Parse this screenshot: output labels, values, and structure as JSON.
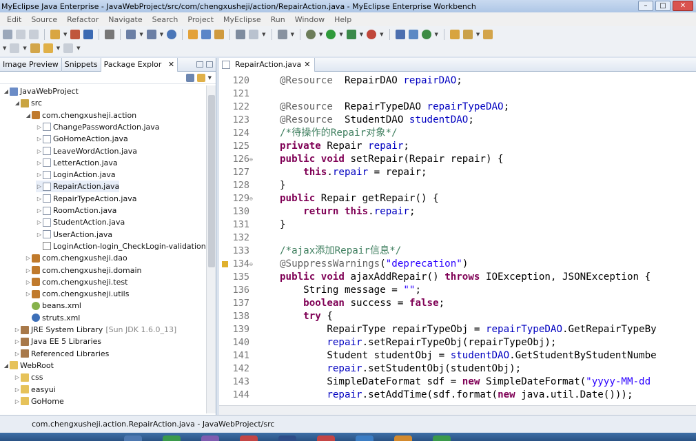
{
  "window": {
    "title": "MyEclipse Java Enterprise - JavaWebProject/src/com/chengxusheji/action/RepairAction.java - MyEclipse Enterprise Workbench"
  },
  "menu": [
    "Edit",
    "Source",
    "Refactor",
    "Navigate",
    "Search",
    "Project",
    "MyEclipse",
    "Run",
    "Window",
    "Help"
  ],
  "left_panel": {
    "tabs": [
      "Image Preview",
      "Snippets",
      "Package Explor"
    ],
    "tree": [
      {
        "label": "JavaWebProject",
        "icon": "project-icon"
      },
      {
        "label": "src",
        "icon": "source-folder-icon"
      },
      {
        "label": "com.chengxusheji.action",
        "icon": "package-icon"
      },
      {
        "label": "ChangePasswordAction.java",
        "icon": "java-file-icon"
      },
      {
        "label": "GoHomeAction.java",
        "icon": "java-file-icon"
      },
      {
        "label": "LeaveWordAction.java",
        "icon": "java-file-icon"
      },
      {
        "label": "LetterAction.java",
        "icon": "java-file-icon"
      },
      {
        "label": "LoginAction.java",
        "icon": "java-file-icon"
      },
      {
        "label": "RepairAction.java",
        "icon": "java-file-icon"
      },
      {
        "label": "RepairTypeAction.java",
        "icon": "java-file-icon"
      },
      {
        "label": "RoomAction.java",
        "icon": "java-file-icon"
      },
      {
        "label": "StudentAction.java",
        "icon": "java-file-icon"
      },
      {
        "label": "UserAction.java",
        "icon": "java-file-icon"
      },
      {
        "label": "LoginAction-login_CheckLogin-validation.xml",
        "icon": "xml-file-icon"
      },
      {
        "label": "com.chengxusheji.dao",
        "icon": "package-icon"
      },
      {
        "label": "com.chengxusheji.domain",
        "icon": "package-icon"
      },
      {
        "label": "com.chengxusheji.test",
        "icon": "package-icon"
      },
      {
        "label": "com.chengxusheji.utils",
        "icon": "package-icon"
      },
      {
        "label": "beans.xml",
        "icon": "beans-xml-icon"
      },
      {
        "label": "struts.xml",
        "icon": "struts-xml-icon"
      },
      {
        "label": "JRE System Library",
        "suffix": "[Sun JDK 1.6.0_13]",
        "icon": "library-icon"
      },
      {
        "label": "Java EE 5 Libraries",
        "icon": "library-icon"
      },
      {
        "label": "Referenced Libraries",
        "icon": "library-icon"
      },
      {
        "label": "WebRoot",
        "icon": "folder-icon"
      },
      {
        "label": "css",
        "icon": "folder-icon"
      },
      {
        "label": "easyui",
        "icon": "folder-icon"
      },
      {
        "label": "GoHome",
        "icon": "folder-icon"
      }
    ]
  },
  "editor": {
    "tab_label": "RepairAction.java",
    "lines": [
      {
        "n": "120",
        "tokens": [
          [
            "ann",
            "@Resource"
          ],
          [
            "",
            "  RepairDAO "
          ],
          [
            "fld",
            "repairDAO"
          ],
          [
            "",
            ";"
          ]
        ]
      },
      {
        "n": "121",
        "tokens": []
      },
      {
        "n": "122",
        "tokens": [
          [
            "ann",
            "@Resource"
          ],
          [
            "",
            "  RepairTypeDAO "
          ],
          [
            "fld",
            "repairTypeDAO"
          ],
          [
            "",
            ";"
          ]
        ]
      },
      {
        "n": "123",
        "tokens": [
          [
            "ann",
            "@Resource"
          ],
          [
            "",
            "  StudentDAO "
          ],
          [
            "fld",
            "studentDAO"
          ],
          [
            "",
            ";"
          ]
        ]
      },
      {
        "n": "124",
        "tokens": [
          [
            "cmt",
            "/*待操作的Repair对象*/"
          ]
        ]
      },
      {
        "n": "125",
        "tokens": [
          [
            "kw",
            "private"
          ],
          [
            "",
            " Repair "
          ],
          [
            "fld",
            "repair"
          ],
          [
            "",
            ";"
          ]
        ]
      },
      {
        "n": "126",
        "fold": true,
        "tokens": [
          [
            "kw",
            "public"
          ],
          [
            "",
            " "
          ],
          [
            "kw",
            "void"
          ],
          [
            "",
            " setRepair(Repair repair) {"
          ]
        ]
      },
      {
        "n": "127",
        "tokens": [
          [
            "",
            "    "
          ],
          [
            "kw",
            "this"
          ],
          [
            "",
            "."
          ],
          [
            "fld",
            "repair"
          ],
          [
            "",
            " = repair;"
          ]
        ]
      },
      {
        "n": "128",
        "tokens": [
          [
            "",
            "}"
          ]
        ]
      },
      {
        "n": "129",
        "fold": true,
        "tokens": [
          [
            "kw",
            "public"
          ],
          [
            "",
            " Repair getRepair() {"
          ]
        ]
      },
      {
        "n": "130",
        "tokens": [
          [
            "",
            "    "
          ],
          [
            "kw",
            "return"
          ],
          [
            "",
            " "
          ],
          [
            "kw",
            "this"
          ],
          [
            "",
            "."
          ],
          [
            "fld",
            "repair"
          ],
          [
            "",
            ";"
          ]
        ]
      },
      {
        "n": "131",
        "tokens": [
          [
            "",
            "}"
          ]
        ]
      },
      {
        "n": "132",
        "tokens": []
      },
      {
        "n": "133",
        "tokens": [
          [
            "cmt",
            "/*ajax添加Repair信息*/"
          ]
        ]
      },
      {
        "n": "134",
        "fold": true,
        "warn": true,
        "tokens": [
          [
            "ann",
            "@SuppressWarnings"
          ],
          [
            "",
            "("
          ],
          [
            "str",
            "\"deprecation\""
          ],
          [
            "",
            ")"
          ]
        ]
      },
      {
        "n": "135",
        "tokens": [
          [
            "kw",
            "public"
          ],
          [
            "",
            " "
          ],
          [
            "kw",
            "void"
          ],
          [
            "",
            " ajaxAddRepair() "
          ],
          [
            "kw",
            "throws"
          ],
          [
            "",
            " IOException, JSONException {"
          ]
        ]
      },
      {
        "n": "136",
        "tokens": [
          [
            "",
            "    String message = "
          ],
          [
            "str",
            "\"\""
          ],
          [
            "",
            ";"
          ]
        ]
      },
      {
        "n": "137",
        "tokens": [
          [
            "",
            "    "
          ],
          [
            "kw",
            "boolean"
          ],
          [
            "",
            " success = "
          ],
          [
            "kw",
            "false"
          ],
          [
            "",
            ";"
          ]
        ]
      },
      {
        "n": "138",
        "tokens": [
          [
            "",
            "    "
          ],
          [
            "kw",
            "try"
          ],
          [
            "",
            " {"
          ]
        ]
      },
      {
        "n": "139",
        "tokens": [
          [
            "",
            "        RepairType repairTypeObj = "
          ],
          [
            "fld",
            "repairTypeDAO"
          ],
          [
            "",
            ".GetRepairTypeBy"
          ]
        ]
      },
      {
        "n": "140",
        "tokens": [
          [
            "",
            "        "
          ],
          [
            "fld",
            "repair"
          ],
          [
            "",
            ".setRepairTypeObj(repairTypeObj);"
          ]
        ]
      },
      {
        "n": "141",
        "tokens": [
          [
            "",
            "        Student studentObj = "
          ],
          [
            "fld",
            "studentDAO"
          ],
          [
            "",
            ".GetStudentByStudentNumbe"
          ]
        ]
      },
      {
        "n": "142",
        "tokens": [
          [
            "",
            "        "
          ],
          [
            "fld",
            "repair"
          ],
          [
            "",
            ".setStudentObj(studentObj);"
          ]
        ]
      },
      {
        "n": "143",
        "tokens": [
          [
            "",
            "        SimpleDateFormat sdf = "
          ],
          [
            "kw",
            "new"
          ],
          [
            "",
            " SimpleDateFormat("
          ],
          [
            "str",
            "\"yyyy-MM-dd"
          ]
        ]
      },
      {
        "n": "144",
        "tokens": [
          [
            "",
            "        "
          ],
          [
            "fld",
            "repair"
          ],
          [
            "",
            ".setAddTime(sdf.format("
          ],
          [
            "kw",
            "new"
          ],
          [
            "",
            " java.util.Date()));"
          ]
        ]
      }
    ]
  },
  "status": {
    "text": "com.chengxusheji.action.RepairAction.java - JavaWebProject/src"
  }
}
